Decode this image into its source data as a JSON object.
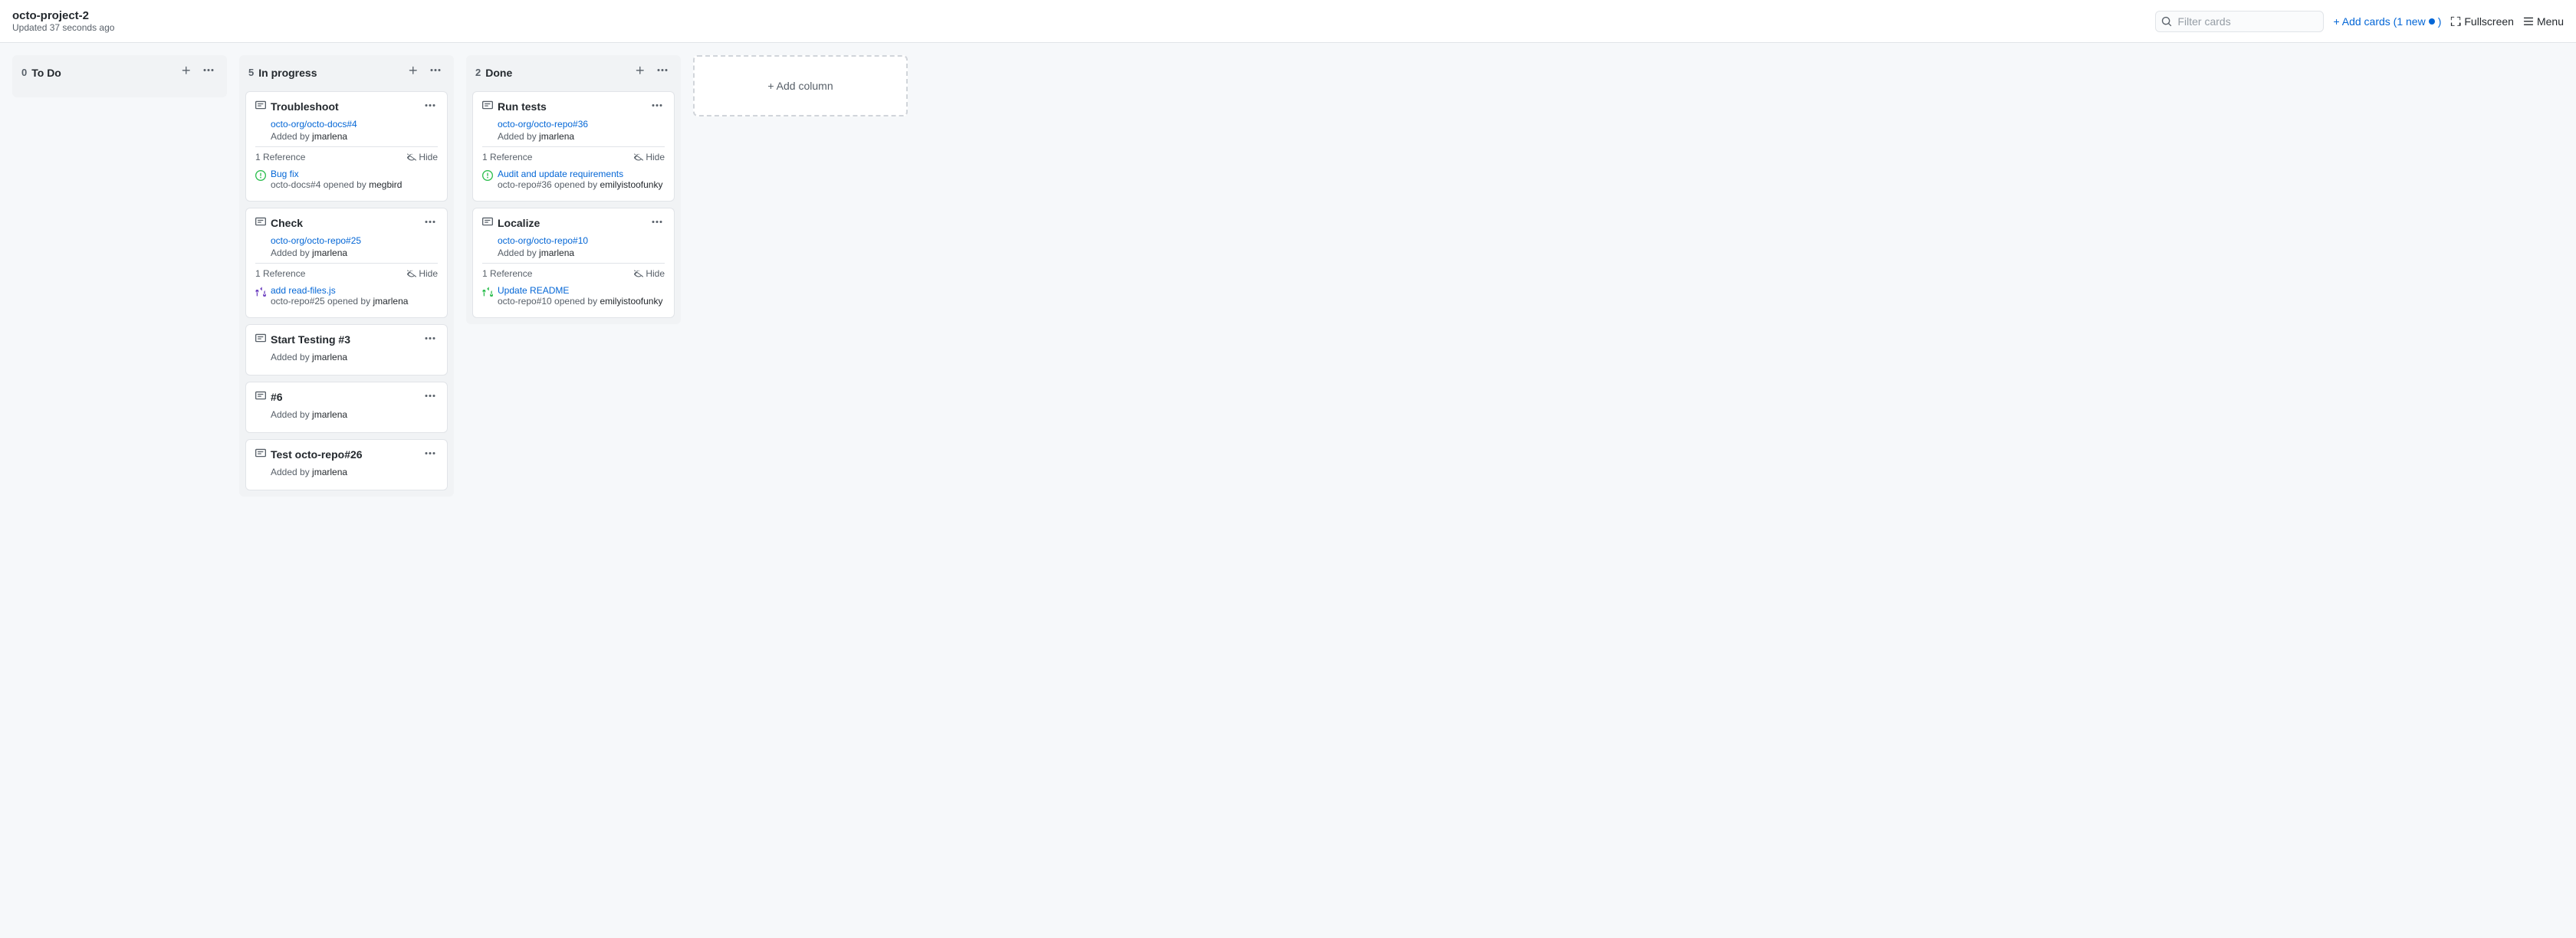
{
  "header": {
    "project_name": "octo-project-2",
    "updated_text": "Updated 37 seconds ago",
    "filter_placeholder": "Filter cards",
    "add_cards_label": "+ Add cards (1 new",
    "fullscreen_label": "Fullscreen",
    "menu_label": "Menu"
  },
  "columns": [
    {
      "id": "todo",
      "count": "0",
      "title": "To Do",
      "cards": []
    },
    {
      "id": "in-progress",
      "count": "5",
      "title": "In progress",
      "cards": [
        {
          "id": "c1",
          "type": "note",
          "title": "Troubleshoot",
          "link": "octo-org/octo-docs#4",
          "link_href": "#",
          "added_by": "jmarlena",
          "references": [
            {
              "icon": "open-issue",
              "title": "Bug fix",
              "title_href": "#",
              "sub": "octo-docs#4 opened by ",
              "sub_user": "megbird"
            }
          ]
        },
        {
          "id": "c2",
          "type": "note",
          "title": "Check",
          "link": "octo-org/octo-repo#25",
          "link_href": "#",
          "added_by": "jmarlena",
          "references": [
            {
              "icon": "pr",
              "title": "add read-files.js",
              "title_href": "#",
              "sub": "octo-repo#25 opened by ",
              "sub_user": "jmarlena"
            }
          ]
        },
        {
          "id": "c3",
          "type": "note",
          "title": "Start Testing #3",
          "link": null,
          "added_by": "jmarlena",
          "references": []
        },
        {
          "id": "c4",
          "type": "note",
          "title": "#6",
          "link": null,
          "added_by": "jmarlena",
          "references": []
        },
        {
          "id": "c5",
          "type": "note",
          "title": "Test octo-repo#26",
          "link": null,
          "added_by": "jmarlena",
          "references": []
        }
      ]
    },
    {
      "id": "done",
      "count": "2",
      "title": "Done",
      "cards": [
        {
          "id": "d1",
          "type": "note",
          "title": "Run tests",
          "link": "octo-org/octo-repo#36",
          "link_href": "#",
          "added_by": "jmarlena",
          "references": [
            {
              "icon": "open-issue",
              "title": "Audit and update requirements",
              "title_href": "#",
              "sub": "octo-repo#36 opened by ",
              "sub_user": "emilyistoofunky"
            }
          ]
        },
        {
          "id": "d2",
          "type": "note",
          "title": "Localize",
          "link": "octo-org/octo-repo#10",
          "link_href": "#",
          "added_by": "jmarlena",
          "references": [
            {
              "icon": "pr-green",
              "title": "Update README",
              "title_href": "#",
              "sub": "octo-repo#10 opened by ",
              "sub_user": "emilyistoofunky"
            }
          ]
        }
      ]
    }
  ],
  "add_column_label": "+ Add column",
  "labels": {
    "reference": "1 Reference",
    "hide": "Hide",
    "added_by_prefix": "Added by "
  }
}
